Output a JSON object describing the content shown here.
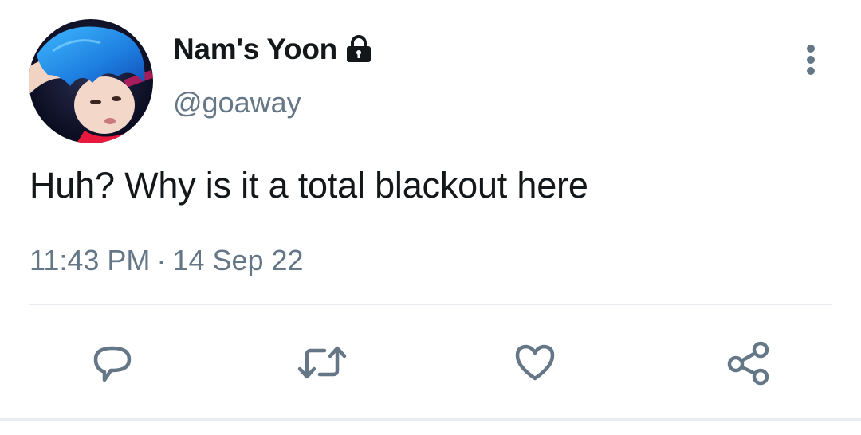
{
  "author": {
    "display_name": "Nam's Yoon",
    "handle": "@goaway",
    "avatar_icon": "profile-photo",
    "protected_icon": "lock-icon"
  },
  "tweet": {
    "text": "Huh? Why is it a total blackout here",
    "time": "11:43 PM",
    "separator": "·",
    "date": "14 Sep 22"
  },
  "actions": [
    {
      "icon": "reply-icon"
    },
    {
      "icon": "retweet-icon"
    },
    {
      "icon": "like-icon"
    },
    {
      "icon": "share-icon"
    }
  ],
  "colors": {
    "text_primary": "#14171a",
    "text_secondary": "#657786",
    "icon_gray": "#657786",
    "divider": "#e6ecf0"
  }
}
